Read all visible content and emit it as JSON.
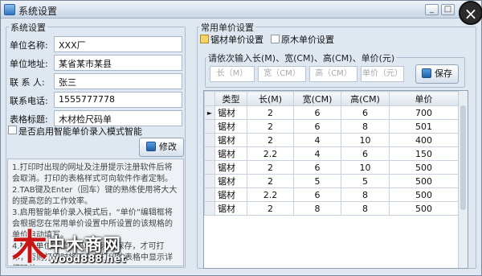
{
  "window": {
    "title": "系统设置",
    "close_glyph": "×",
    "min_glyph": "_",
    "max_glyph": "□"
  },
  "system": {
    "group_title": "系统设置",
    "fields": [
      {
        "label": "单位名称:",
        "value": "XXX厂"
      },
      {
        "label": "单位地址:",
        "value": "某省某市某县"
      },
      {
        "label": "联 系 人:",
        "value": "张三"
      },
      {
        "label": "联系电话:",
        "value": "1555777778"
      },
      {
        "label": "表格标题:",
        "value": "木材检尺码单"
      }
    ],
    "smart_entry_label": "是否启用智能单价录入模式智能",
    "smart_entry_checked": false,
    "modify_button": "修改",
    "notes": [
      "1.打印时出现的网址及注册提示注册软件后将会取消。打印的表格样式可向软件作者定制。",
      "2.TAB键及Enter（回车）键的熟练使用将大大的提高您的工作效率。",
      "3.启用智能单价录入模式后，“单价”编辑框将会根据您在常用单价设置中所设置的该规格的单价自动填写。",
      "4.检尺单位的检尺码单必须先保存，才可打印，否则打印时将不会在打印的表格中显示详细码单。"
    ]
  },
  "price": {
    "group_title": "常用单价设置",
    "options": [
      {
        "label": "锯材单价设置",
        "checked": true
      },
      {
        "label": "原木单价设置",
        "checked": false
      }
    ],
    "input_group_title": "请依次输入长(M)、宽(CM)、高(CM)、单价(元)",
    "placeholders": [
      "长（M）",
      "宽（CM）",
      "高（CM）",
      "单价（元）"
    ],
    "save_button": "保存",
    "table": {
      "columns": [
        "类型",
        "长(M)",
        "宽(CM)",
        "高(CM)",
        "单价"
      ],
      "rows": [
        [
          "锯材",
          "2",
          "6",
          "6",
          "700"
        ],
        [
          "锯材",
          "2",
          "6",
          "8",
          "501"
        ],
        [
          "锯材",
          "2",
          "4",
          "10",
          "400"
        ],
        [
          "锯材",
          "2.2",
          "4",
          "6",
          "150"
        ],
        [
          "锯材",
          "2",
          "6",
          "10",
          "500"
        ],
        [
          "锯材",
          "2",
          "5",
          "5",
          "500"
        ],
        [
          "锯材",
          "2.2",
          "6",
          "8",
          "500"
        ],
        [
          "锯材",
          "2",
          "8",
          "8",
          "500"
        ]
      ],
      "current_row_marker": "►"
    }
  },
  "watermark": {
    "logo_glyph": "木",
    "name": "中木商网",
    "url": "wood888.net"
  }
}
